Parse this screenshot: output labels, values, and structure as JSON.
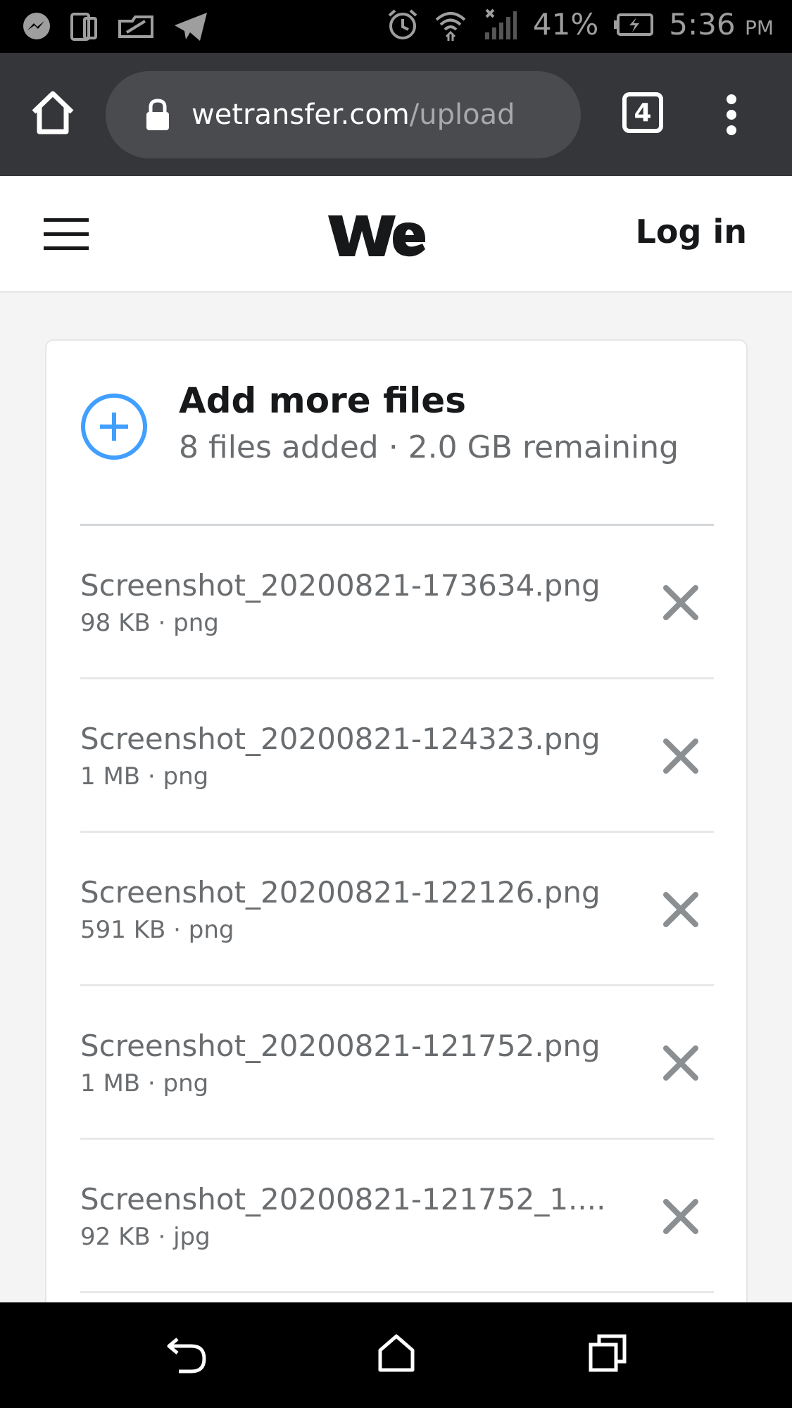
{
  "status_bar": {
    "battery": "41%",
    "time": "5:36",
    "ampm": "PM",
    "icons": [
      "messenger-icon",
      "sim-icon",
      "app-icon",
      "telegram-icon",
      "alarm-icon",
      "wifi-icon",
      "signal-icon",
      "battery-icon"
    ]
  },
  "browser": {
    "url_domain": "wetransfer.com",
    "url_path": "/upload",
    "tab_count": "4"
  },
  "header": {
    "login_label": "Log in"
  },
  "upload": {
    "title": "Add more files",
    "subtitle": "8 files added · 2.0 GB remaining",
    "files": [
      {
        "name": "Screenshot_20200821-173634.png",
        "meta": "98 KB · png"
      },
      {
        "name": "Screenshot_20200821-124323.png",
        "meta": "1 MB · png"
      },
      {
        "name": "Screenshot_20200821-122126.png",
        "meta": "591 KB · png"
      },
      {
        "name": "Screenshot_20200821-121752.png",
        "meta": "1 MB · png"
      },
      {
        "name": "Screenshot_20200821-121752_1....",
        "meta": "92 KB · jpg"
      }
    ]
  },
  "colors": {
    "accent_blue": "#409fff",
    "toolbar": "#35363a",
    "url_box": "#4a4b4f"
  }
}
